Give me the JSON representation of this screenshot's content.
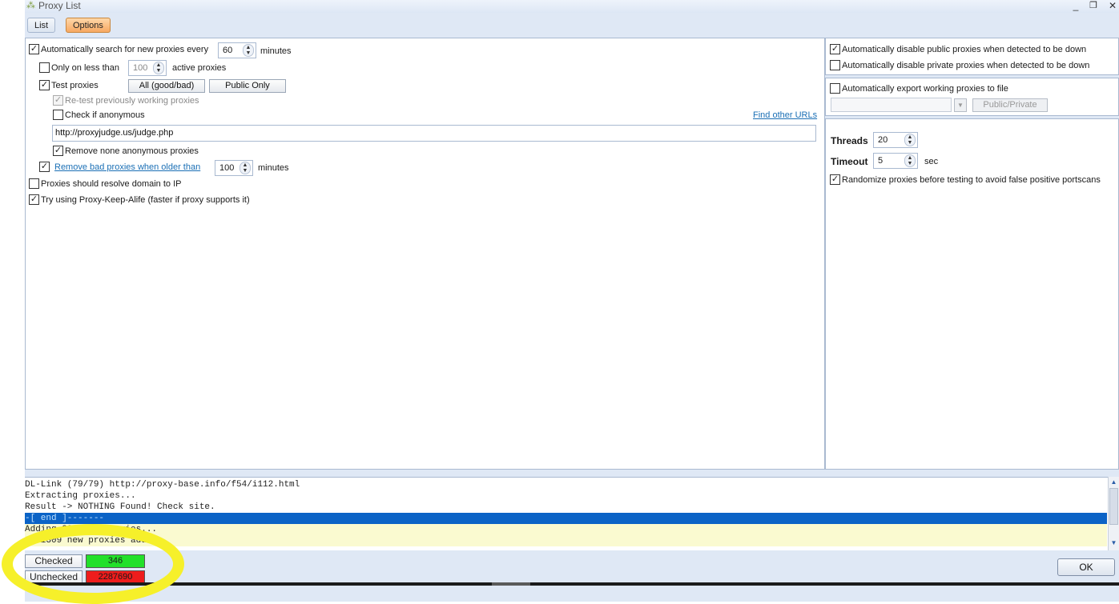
{
  "window": {
    "title": "Proxy List",
    "minimize": "_",
    "maximize": "❐",
    "close": "✕"
  },
  "tabs": [
    {
      "label": "List",
      "active": false
    },
    {
      "label": "Options",
      "active": true
    }
  ],
  "left": {
    "auto_search": {
      "checked": true,
      "label": "Automatically search for new proxies every",
      "value": "60",
      "unit": "minutes"
    },
    "only_less": {
      "checked": false,
      "label": "Only on less than",
      "value": "100",
      "unit": "active proxies"
    },
    "test_proxies": {
      "checked": true,
      "label": "Test proxies",
      "btn_all": "All (good/bad)",
      "btn_public": "Public Only"
    },
    "retest": {
      "checked": true,
      "disabled": true,
      "label": "Re-test previously working proxies"
    },
    "check_anon": {
      "checked": false,
      "label": "Check if anonymous",
      "link": "Find other URLs"
    },
    "judge_url": "http://proxyjudge.us/judge.php",
    "remove_none_anon": {
      "checked": true,
      "label": "Remove none anonymous proxies"
    },
    "remove_bad": {
      "checked": true,
      "label": "Remove bad proxies when older than",
      "value": "100",
      "unit": "minutes"
    },
    "resolve_domain": {
      "checked": false,
      "label": "Proxies should resolve domain to IP"
    },
    "keep_alive": {
      "checked": true,
      "label": "Try using Proxy-Keep-Alife (faster if proxy supports it)"
    }
  },
  "right": {
    "disable_public": {
      "checked": true,
      "label": "Automatically disable public proxies when detected to be down"
    },
    "disable_private": {
      "checked": false,
      "label": "Automatically disable private proxies when detected to be down"
    },
    "export": {
      "checked": false,
      "label": "Automatically export working proxies to file",
      "select_value": "",
      "btn": "Public/Private"
    },
    "threads": {
      "label": "Threads",
      "value": "20"
    },
    "timeout": {
      "label": "Timeout",
      "value": "5",
      "unit": "sec"
    },
    "randomize": {
      "checked": true,
      "label": "Randomize proxies before testing to avoid false positive portscans"
    }
  },
  "log": [
    "DL-Link (79/79) http://proxy-base.info/f54/i112.html",
    "Extracting proxies...",
    "Result -> NOTHING Found! Check site.",
    "-[ end ]-------",
    "Adding 2295616 proxies...",
    "2281309 new proxies added."
  ],
  "log_selected_index": 3,
  "status": {
    "checked_label": "Checked",
    "checked_value": "346",
    "checked_color": "#22e02a",
    "unchecked_label": "Unchecked",
    "unchecked_value": "2287690",
    "unchecked_color": "#ee1c1c"
  },
  "ok_label": "OK",
  "colors": {
    "accent_tab": "#f7a862",
    "selection": "#0b63c6",
    "highlight": "#f6f02a",
    "link": "#1a6fb5"
  }
}
